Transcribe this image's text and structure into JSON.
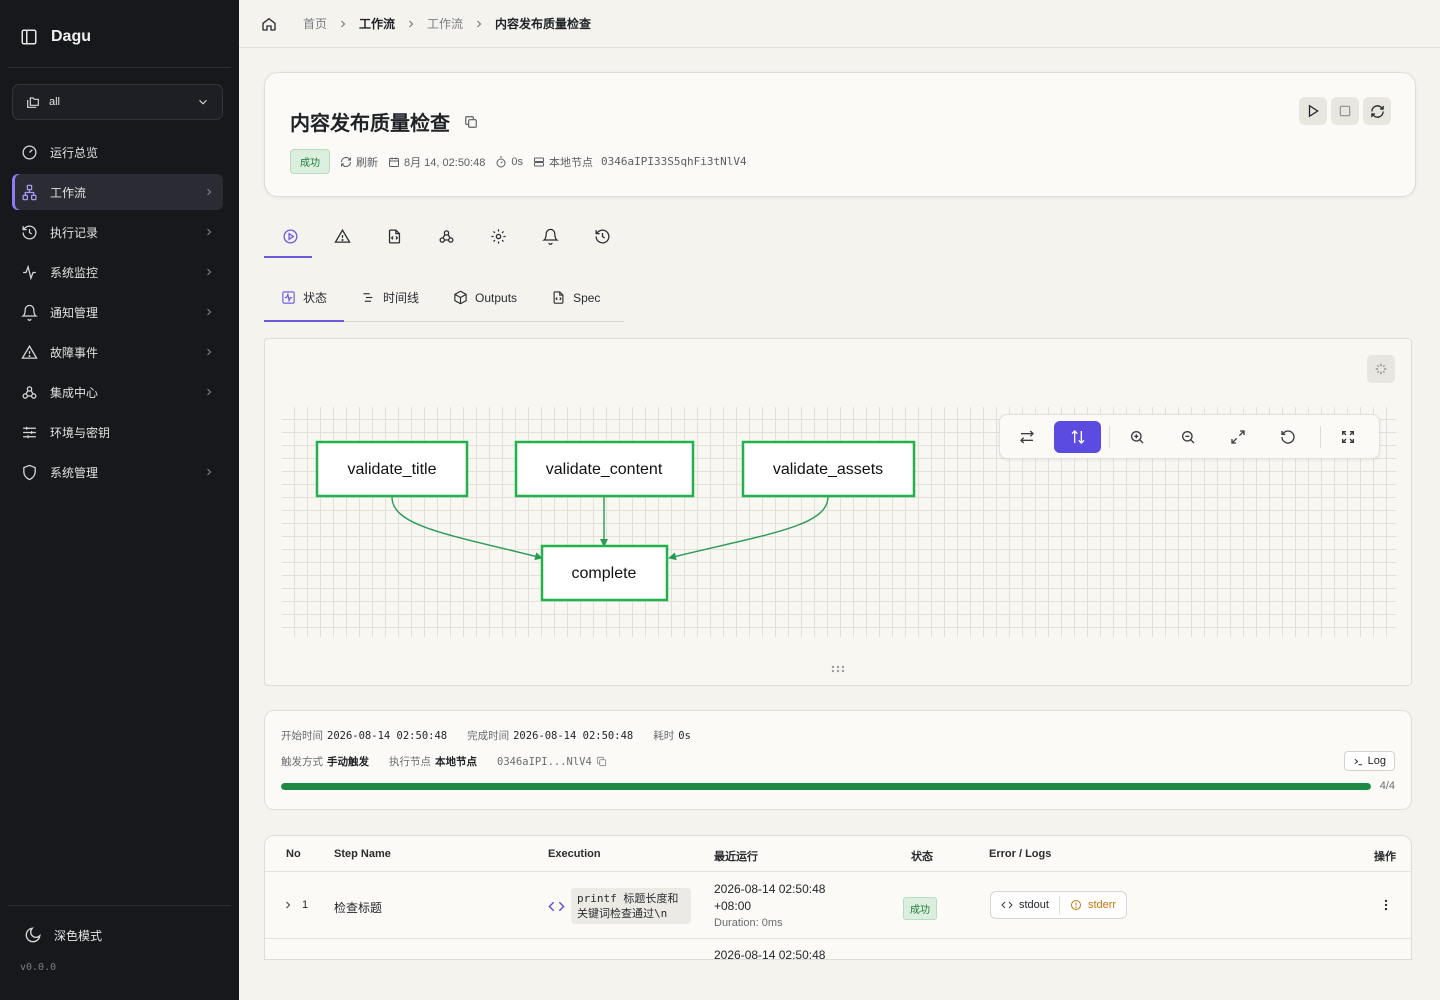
{
  "app": {
    "name": "Dagu",
    "version": "v0.0.0",
    "dark_mode_label": "深色模式"
  },
  "namespace": {
    "value": "all"
  },
  "nav": [
    {
      "label": "运行总览",
      "icon": "gauge-icon",
      "chevron": false,
      "active": false
    },
    {
      "label": "工作流",
      "icon": "workflow-icon",
      "chevron": true,
      "active": true
    },
    {
      "label": "执行记录",
      "icon": "history-icon",
      "chevron": true,
      "active": false
    },
    {
      "label": "系统监控",
      "icon": "activity-icon",
      "chevron": true,
      "active": false
    },
    {
      "label": "通知管理",
      "icon": "bell-icon",
      "chevron": true,
      "active": false
    },
    {
      "label": "故障事件",
      "icon": "alert-icon",
      "chevron": true,
      "active": false
    },
    {
      "label": "集成中心",
      "icon": "webhook-icon",
      "chevron": true,
      "active": false
    },
    {
      "label": "环境与密钥",
      "icon": "sliders-icon",
      "chevron": false,
      "active": false
    },
    {
      "label": "系统管理",
      "icon": "shield-icon",
      "chevron": true,
      "active": false
    }
  ],
  "breadcrumb": [
    "首页",
    "工作流",
    "工作流",
    "内容发布质量检查"
  ],
  "header": {
    "title": "内容发布质量检查",
    "status": "成功",
    "refresh": "刷新",
    "date": "8月 14, 02:50:48",
    "duration": "0s",
    "node_label": "本地节点",
    "node_id": "0346aIPI33S5qhFi3tNlV4"
  },
  "sub_tabs": [
    "状态",
    "时间线",
    "Outputs",
    "Spec"
  ],
  "graph": {
    "nodes": [
      "validate_title",
      "validate_content",
      "validate_assets",
      "complete"
    ],
    "edges": [
      [
        "validate_title",
        "complete"
      ],
      [
        "validate_content",
        "complete"
      ],
      [
        "validate_assets",
        "complete"
      ]
    ],
    "colors": {
      "node_border": "#22b14c",
      "edge": "#2b9a55"
    }
  },
  "summary": {
    "start_label": "开始时间",
    "start": "2026-08-14 02:50:48",
    "end_label": "完成时间",
    "end": "2026-08-14 02:50:48",
    "elapsed_label": "耗时",
    "elapsed": "0s",
    "trigger_label": "触发方式",
    "trigger": "手动触发",
    "node_label": "执行节点",
    "node": "本地节点",
    "node_id": "0346aIPI...NlV4",
    "log_button": "Log",
    "progress_done": 4,
    "progress_total": 4,
    "progress_text": "4/4"
  },
  "table": {
    "headers": [
      "No",
      "Step Name",
      "Execution",
      "最近运行",
      "状态",
      "Error / Logs",
      "操作"
    ],
    "rows": [
      {
        "no": "1",
        "name": "检查标题",
        "command_line1": "printf 标题长度和",
        "command_line2": "关键词检查通过\\n",
        "last_run": "2026-08-14 02:50:48",
        "tz": "+08:00",
        "duration_label": "Duration:",
        "duration": "0ms",
        "status": "成功",
        "stdout": "stdout",
        "stderr": "stderr"
      }
    ],
    "partial_next_row_time": "2026-08-14 02:50:48"
  },
  "colors": {
    "accent": "#5b4be0",
    "success": "#1f8a46",
    "sidebar_bg": "#17181c",
    "stderr": "#c7740a"
  }
}
